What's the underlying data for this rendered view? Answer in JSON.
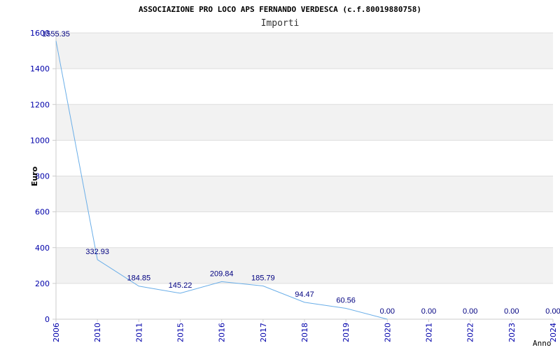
{
  "chart_data": {
    "type": "line",
    "title": "ASSOCIAZIONE PRO LOCO APS FERNANDO VERDESCA (c.f.80019880758)",
    "subtitle": "Importi",
    "xlabel": "Anno",
    "ylabel": "Euro",
    "categories": [
      "2006",
      "2010",
      "2011",
      "2015",
      "2016",
      "2017",
      "2018",
      "2019",
      "2020",
      "2021",
      "2022",
      "2023",
      "2024"
    ],
    "values": [
      1555.35,
      332.93,
      184.85,
      145.22,
      209.84,
      185.79,
      94.47,
      60.56,
      0.0,
      0.0,
      0.0,
      0.0,
      0.0
    ],
    "value_labels": [
      "1555.35",
      "332.93",
      "184.85",
      "145.22",
      "209.84",
      "185.79",
      "94.47",
      "60.56",
      "0.00",
      "0.00",
      "0.00",
      "0.00",
      "0.00"
    ],
    "line_end_index": 8,
    "ylim": [
      0,
      1600
    ],
    "yticks": [
      0,
      200,
      400,
      600,
      800,
      1000,
      1200,
      1400,
      1600
    ],
    "grid": true,
    "line_color": "#6aaee8",
    "band_color": "#f2f2f2",
    "tick_color": "#0000aa"
  }
}
